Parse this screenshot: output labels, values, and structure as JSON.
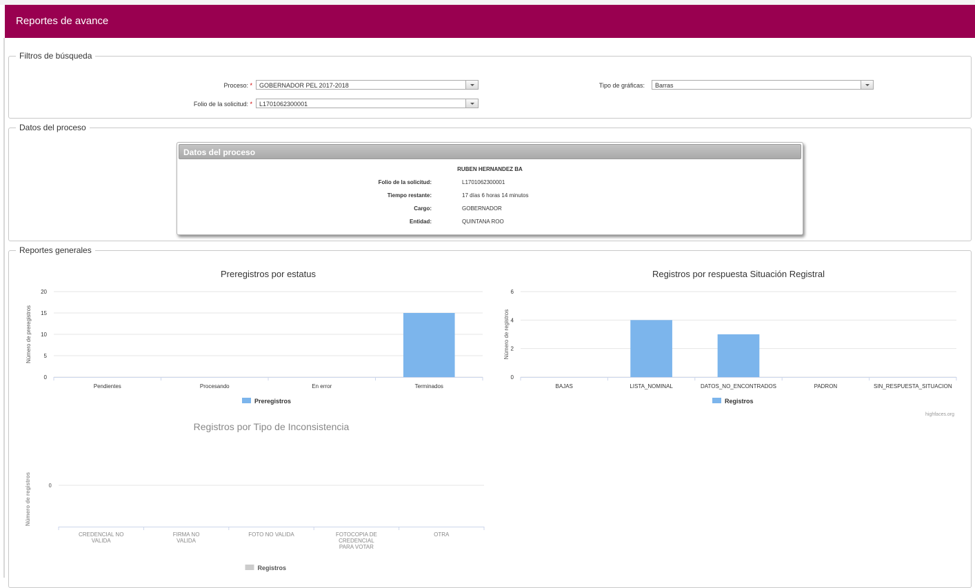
{
  "header": {
    "title": "Reportes de avance"
  },
  "filters": {
    "legend": "Filtros de búsqueda",
    "proceso_label": "Proceso:",
    "proceso_value": "GOBERNADOR PEL 2017-2018",
    "folio_label": "Folio de la solicitud:",
    "folio_value": "L1701062300001",
    "tipo_label": "Tipo de gráficas:",
    "tipo_value": "Barras",
    "required_mark": "*"
  },
  "proceso": {
    "legend": "Datos del proceso",
    "panel_title": "Datos del proceso",
    "name": "RUBEN HERNANDEZ BA",
    "rows": [
      {
        "label": "Folio de la solicitud:",
        "value": "L1701062300001"
      },
      {
        "label": "Tiempo restante:",
        "value": "17 días  6 horas  14 minutos"
      },
      {
        "label": "Cargo:",
        "value": "GOBERNADOR"
      },
      {
        "label": "Entidad:",
        "value": "QUINTANA ROO"
      }
    ]
  },
  "reportes": {
    "legend": "Reportes generales",
    "credit": "highfaces.org"
  },
  "chart_data": [
    {
      "type": "bar",
      "title": "Preregistros por estatus",
      "xlabel": "",
      "ylabel": "Número de preregistros",
      "categories": [
        "Pendientes",
        "Procesando",
        "En error",
        "Terminados"
      ],
      "series": [
        {
          "name": "Preregistros",
          "values": [
            0,
            0,
            0,
            15
          ]
        }
      ],
      "ylim": [
        0,
        20
      ],
      "yticks": [
        0,
        5,
        10,
        15,
        20
      ],
      "grid": true,
      "legend": "bottom",
      "color": "#7cb5ec"
    },
    {
      "type": "bar",
      "title": "Registros por respuesta Situación Registral",
      "xlabel": "",
      "ylabel": "Número de registros",
      "categories": [
        "BAJAS",
        "LISTA_NOMINAL",
        "DATOS_NO_ENCONTRADOS",
        "PADRON",
        "SIN_RESPUESTA_SITUACION"
      ],
      "series": [
        {
          "name": "Registros",
          "values": [
            0,
            4,
            3,
            0,
            0
          ]
        }
      ],
      "ylim": [
        0,
        6
      ],
      "yticks": [
        0,
        2,
        4,
        6
      ],
      "grid": true,
      "legend": "bottom",
      "color": "#7cb5ec"
    },
    {
      "type": "bar",
      "title": "Registros por Tipo de Inconsistencia",
      "xlabel": "",
      "ylabel": "Número de registros",
      "categories": [
        "CREDENCIAL NO VALIDA",
        "FIRMA NO VALIDA",
        "FOTO NO VALIDA",
        "FOTOCOPIA DE CREDENCIAL PARA VOTAR",
        "OTRA"
      ],
      "series": [
        {
          "name": "Registros",
          "values": [
            0,
            0,
            0,
            0,
            0
          ]
        }
      ],
      "yticks": [
        0
      ],
      "grid": true,
      "legend": "bottom",
      "color": "#cccccc"
    }
  ]
}
